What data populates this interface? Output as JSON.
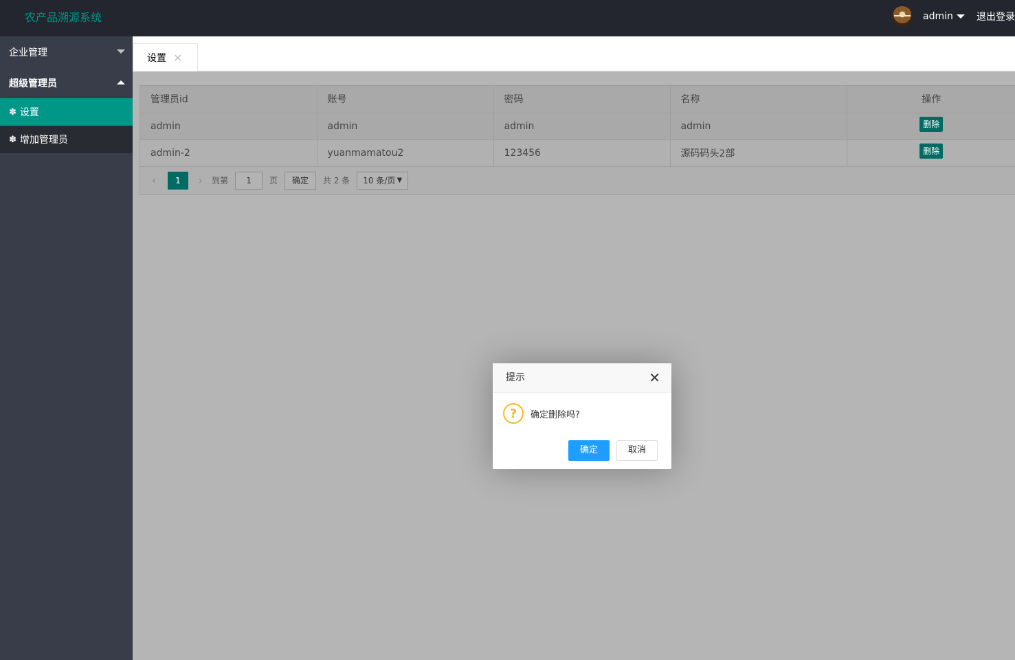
{
  "header": {
    "logo": "农产品溯源系统",
    "user_name": "admin",
    "logout": "退出登录"
  },
  "sidebar": {
    "groups": [
      {
        "label": "企业管理",
        "expanded": false
      },
      {
        "label": "超级管理员",
        "expanded": true,
        "children": [
          {
            "label": "设置",
            "active": true,
            "icon": "gear-icon"
          },
          {
            "label": "增加管理员",
            "active": false,
            "icon": "gear-icon"
          }
        ]
      }
    ]
  },
  "tabs": [
    {
      "label": "设置",
      "close": "✕"
    }
  ],
  "table": {
    "columns": [
      "管理员id",
      "账号",
      "密码",
      "名称",
      "操作"
    ],
    "rows": [
      {
        "id": "admin",
        "account": "admin",
        "password": "admin",
        "name": "admin",
        "action": "删除"
      },
      {
        "id": "admin-2",
        "account": "yuanmamatou2",
        "password": "123456",
        "name": "源码码头2部",
        "action": "删除"
      }
    ]
  },
  "pager": {
    "prev": "‹",
    "current": "1",
    "next": "›",
    "goto_label": "到第",
    "goto_value": "1",
    "page_label": "页",
    "confirm": "确定",
    "total": "共 2 条",
    "page_size": "10 条/页",
    "page_size_caret": "▼"
  },
  "dialog": {
    "title": "提示",
    "close": "✕",
    "icon": "?",
    "message": "确定删除吗?",
    "ok": "确定",
    "cancel": "取消"
  },
  "colors": {
    "accent": "#009688",
    "header_bg": "#23262e",
    "sidebar_bg": "#393d49",
    "dialog_ok": "#1e9fff",
    "warning": "#f7b824"
  }
}
